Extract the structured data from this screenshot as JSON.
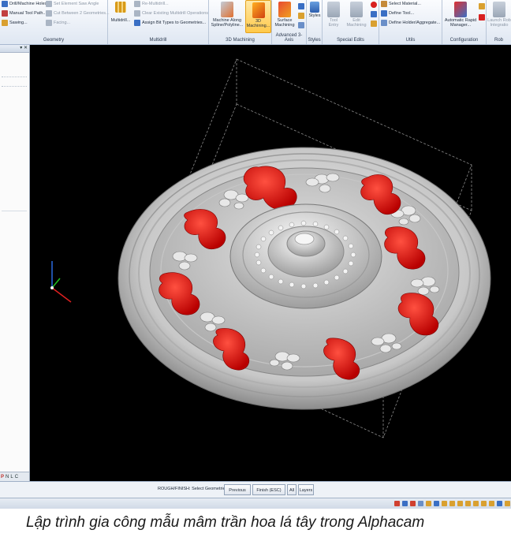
{
  "ribbon": {
    "geometry": {
      "group_label": "Geometry",
      "items": [
        "Drill/Machine Holes",
        "Manual Tool Path...",
        "Sawing..."
      ],
      "items2": [
        "Set Element Saw Angle",
        "Cut Between 2 Geometries...",
        "Facing..."
      ]
    },
    "multidrill": {
      "group_label": "Multidrill",
      "button": "Multidrill...",
      "items": [
        "Re-Multidrill...",
        "Clear Existing Multidrill Operations",
        "Assign Bit Types to Geometries..."
      ]
    },
    "machining3d": {
      "group_label": "3D Machining",
      "spline_line1": "Machine Along",
      "spline_line2": "Spline/Polyline...",
      "m3d_line1": "3D",
      "m3d_line2": "Machining..."
    },
    "advanced": {
      "group_label": "Advanced 3-Axis",
      "surface_line1": "Surface",
      "surface_line2": "Machining"
    },
    "styles": {
      "group_label": "Styles",
      "button": "Styles"
    },
    "special": {
      "group_label": "Special Edits",
      "tool_entry_line1": "Tool",
      "tool_entry_line2": "Entry",
      "edit_line1": "Edit",
      "edit_line2": "Machining"
    },
    "utils": {
      "group_label": "Utils",
      "items": [
        "Select Material...",
        "Define Tool...",
        "Define Holder/Aggregate..."
      ]
    },
    "configuration": {
      "group_label": "Configuration",
      "line1": "Automatic Rapid",
      "line2": "Manager..."
    },
    "robot": {
      "group_label": "Rob",
      "line1": "Launch Rob",
      "line2": "Integratio"
    }
  },
  "panel": {
    "pin": "▾ ✕",
    "tabs": [
      "P",
      "N",
      "L",
      "C"
    ]
  },
  "status": {
    "prompt": "ROUGH/FINISH: Select Geometries",
    "previous": "Previous",
    "finish": "Finish (ESC)",
    "all": "All",
    "layers": "Layers"
  },
  "caption": "Lập trình gia công mẫu mâm trần hoa lá tây trong Alphacam",
  "colors": {
    "accent": "#ffc94a",
    "leaf": "#e00000",
    "viewport": "#000000"
  }
}
